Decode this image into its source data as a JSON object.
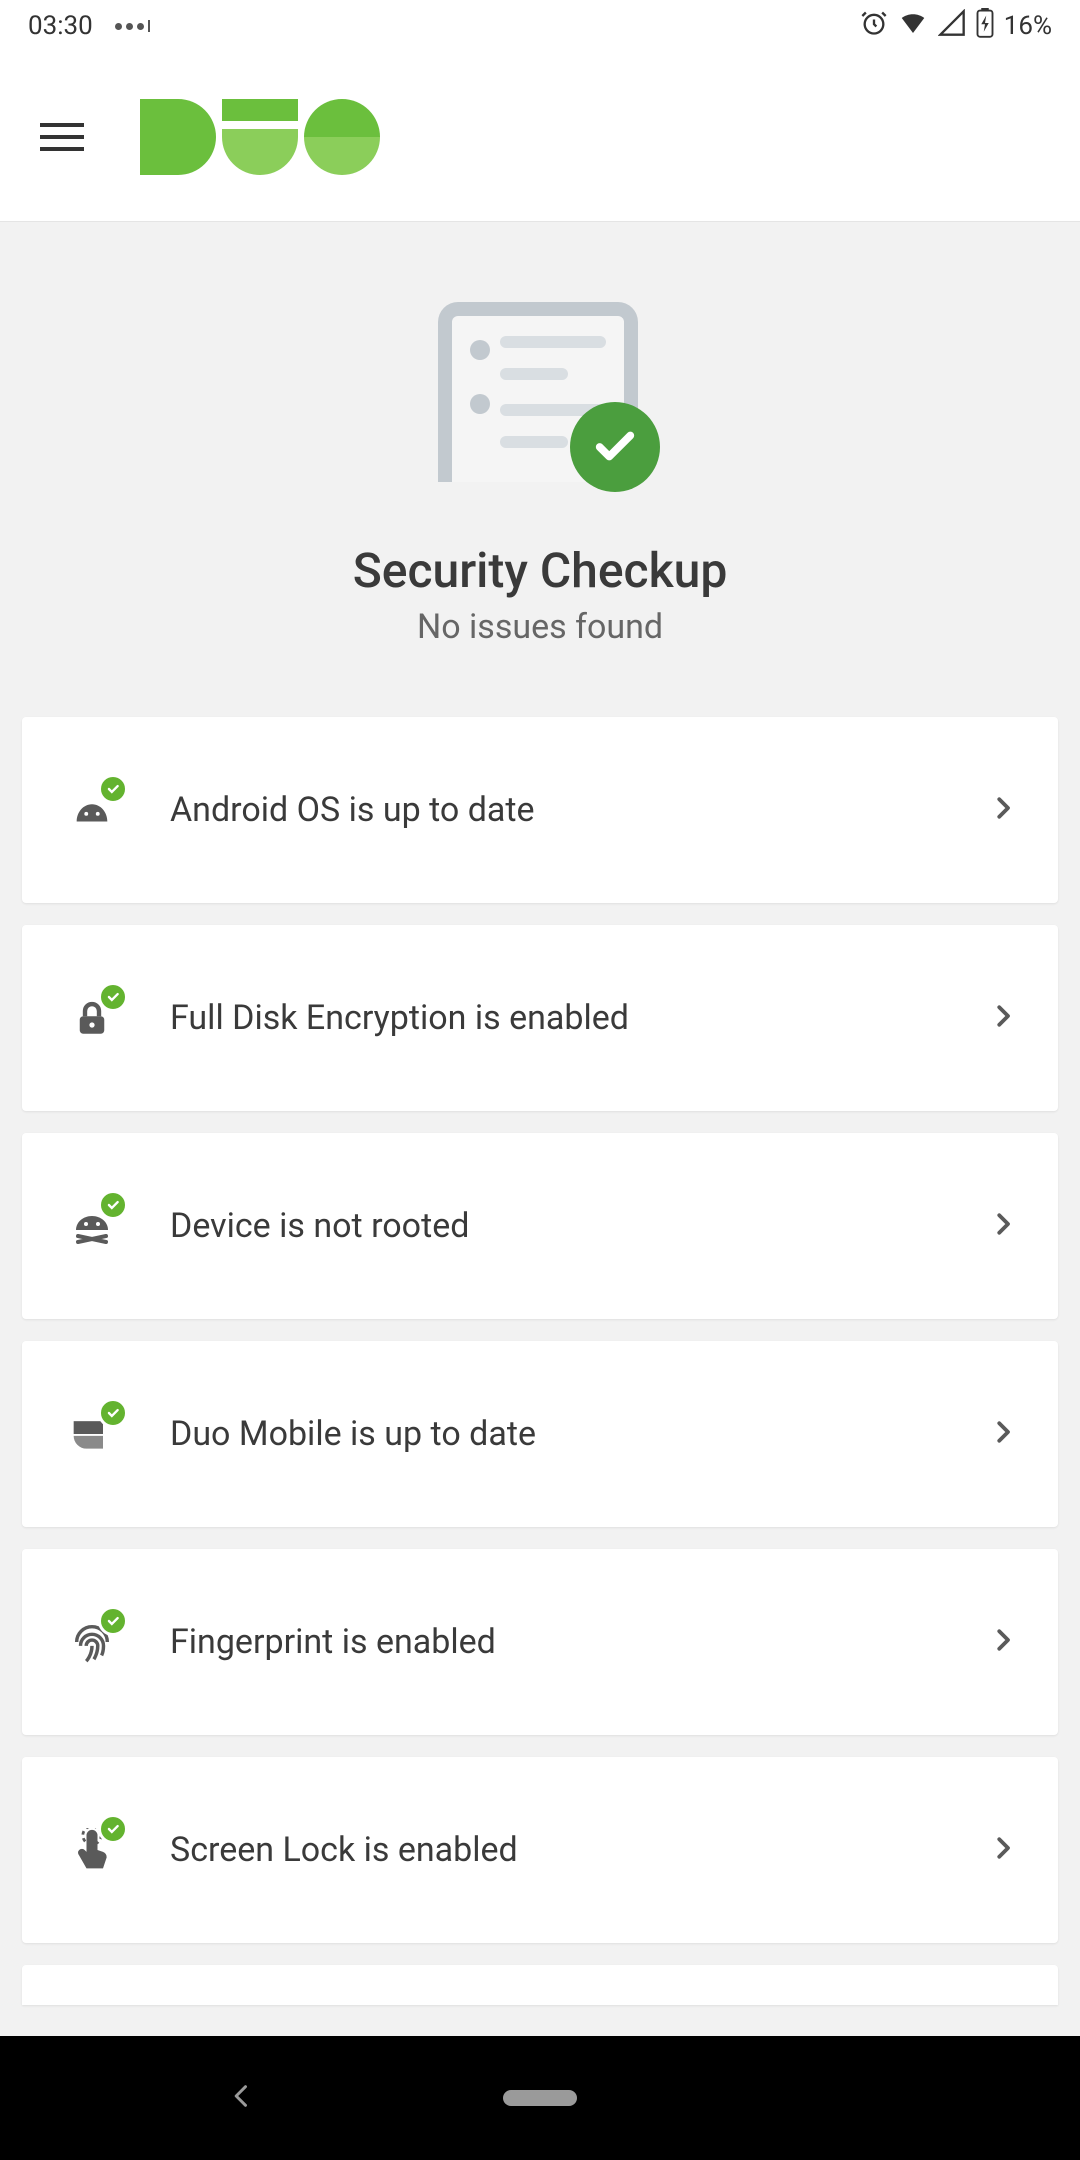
{
  "status": {
    "time": "03:30",
    "battery_text": "16%"
  },
  "header": {
    "title": "Security Checkup",
    "subtitle": "No issues found"
  },
  "checks": [
    {
      "icon": "android-icon",
      "label": "Android OS is up to date",
      "status": "ok"
    },
    {
      "icon": "lock-icon",
      "label": "Full Disk Encryption is enabled",
      "status": "ok"
    },
    {
      "icon": "root-icon",
      "label": "Device is not rooted",
      "status": "ok"
    },
    {
      "icon": "duo-icon",
      "label": "Duo Mobile is up to date",
      "status": "ok"
    },
    {
      "icon": "fingerprint-icon",
      "label": "Fingerprint is enabled",
      "status": "ok"
    },
    {
      "icon": "touch-icon",
      "label": "Screen Lock is enabled",
      "status": "ok"
    }
  ]
}
